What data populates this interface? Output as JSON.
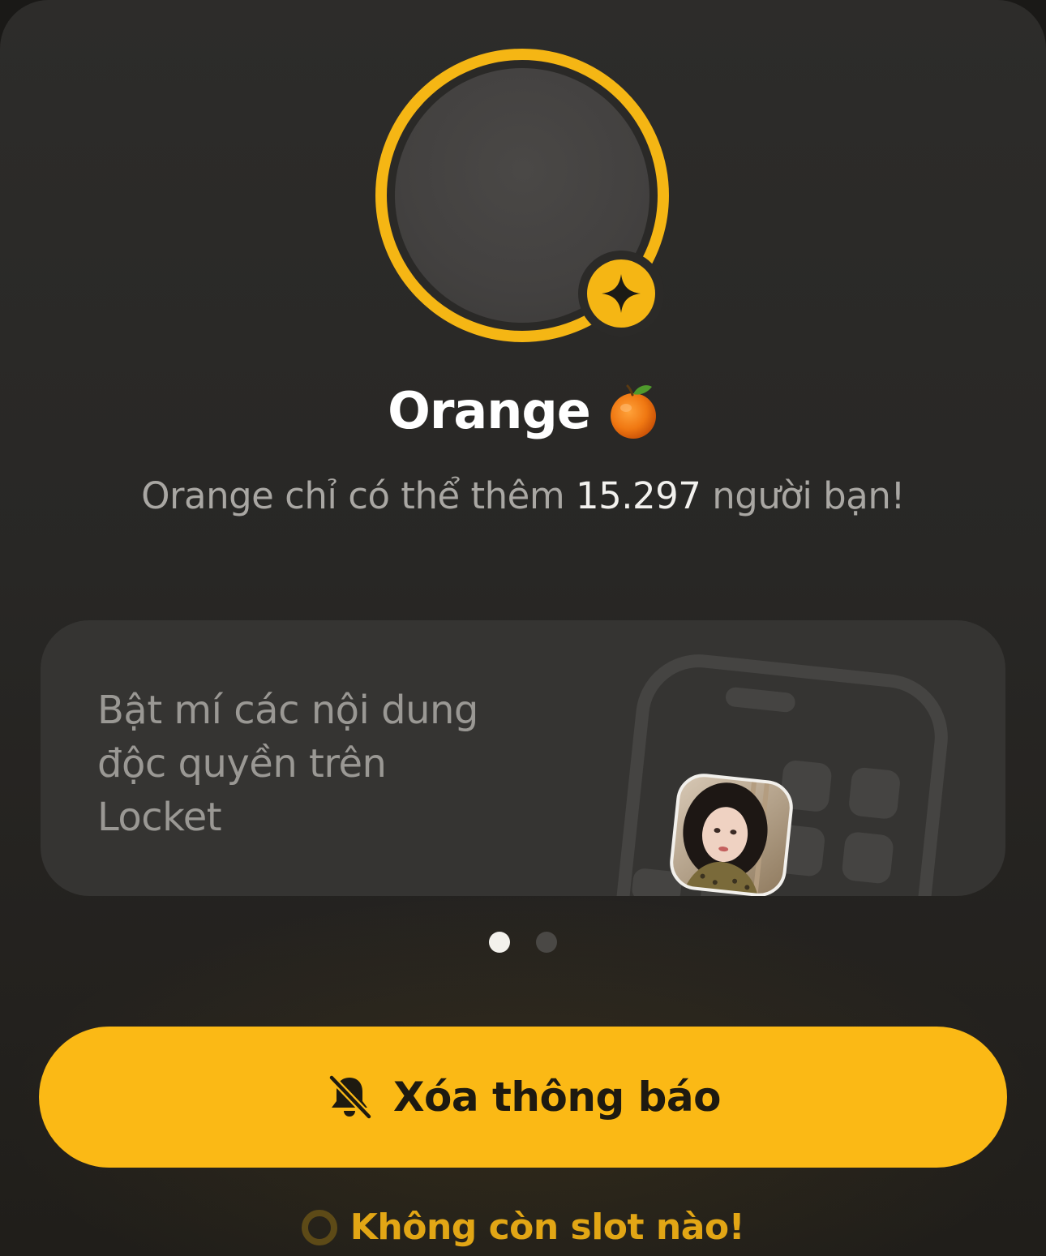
{
  "profile": {
    "name": "Orange",
    "name_emoji": "orange-emoji",
    "badge_icon": "sparkle-star-icon"
  },
  "subtitle": {
    "prefix": "Orange chỉ có thể thêm ",
    "count": "15.297",
    "suffix": " người bạn!"
  },
  "promo_card": {
    "text": "Bật mí các nội dung độc quyền trên Locket",
    "illustration": "phone-widget-illustration"
  },
  "pagination": {
    "total": 2,
    "active_index": 0
  },
  "primary_button": {
    "icon": "bell-slash-icon",
    "label": "Xóa thông báo"
  },
  "slot_status": {
    "icon": "empty-ring-icon",
    "label": "Không còn slot nào!"
  },
  "colors": {
    "accent": "#fbb915",
    "background": "#2b2a28",
    "card": "#353432",
    "text_primary": "#ffffff",
    "text_secondary": "#a9a7a3",
    "warning_text": "#e2a615"
  }
}
